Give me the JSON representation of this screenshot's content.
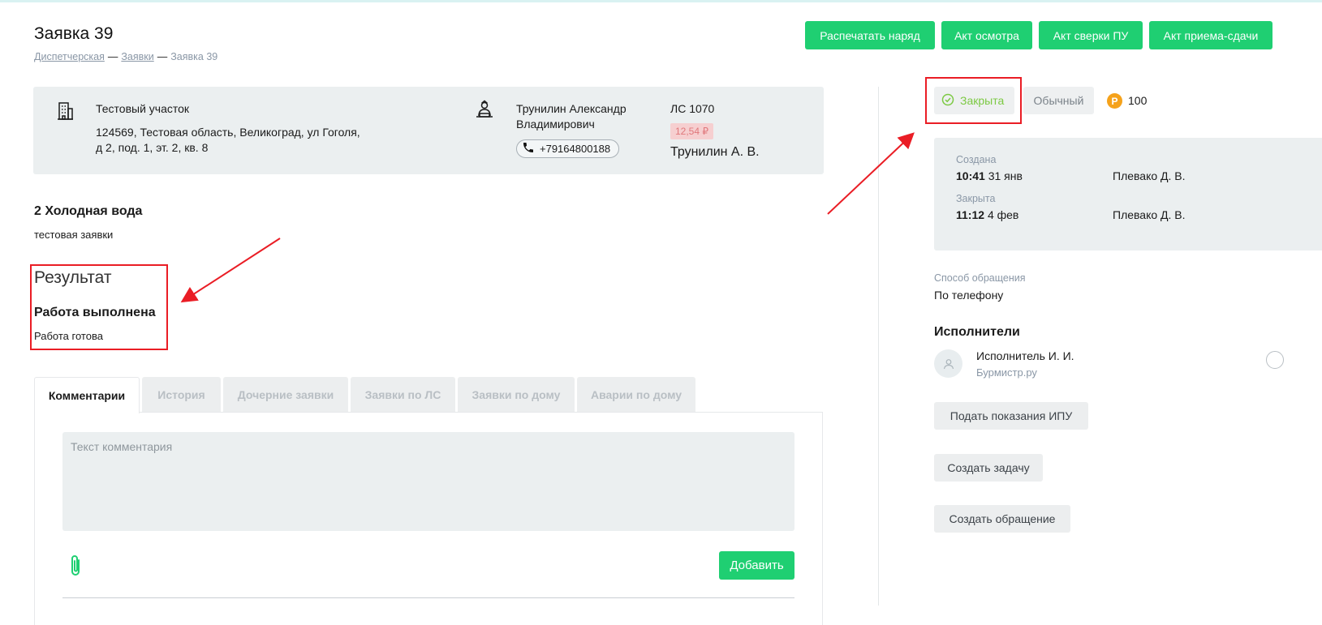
{
  "header": {
    "title": "Заявка 39",
    "breadcrumb": [
      "Диспетчерская",
      "Заявки",
      "Заявка 39"
    ],
    "buttons": [
      "Распечатать наряд",
      "Акт осмотра",
      "Акт сверки ПУ",
      "Акт приема-сдачи"
    ]
  },
  "info": {
    "site_name": "Тестовый участок",
    "address_line1": "124569, Тестовая область, Великоград, ул Гоголя,",
    "address_line2": "д 2, под. 1, эт. 2, кв. 8",
    "person_line1": "Трунилин Александр",
    "person_line2": "Владимирович",
    "phone": "+79164800188",
    "account": "ЛС 1070",
    "debt": "12,54 ₽",
    "owner_short": "Трунилин А. В."
  },
  "request": {
    "service": "2 Холодная вода",
    "description": "тестовая заявки"
  },
  "result": {
    "heading": "Результат",
    "status": "Работа выполнена",
    "description": "Работа готова"
  },
  "tabs": [
    "Комментарии",
    "История",
    "Дочерние заявки",
    "Заявки по ЛС",
    "Заявки по дому",
    "Аварии по дому"
  ],
  "comment": {
    "placeholder": "Текст комментария",
    "add_label": "Добавить"
  },
  "side": {
    "status": "Закрыта",
    "priority": "Обычный",
    "coin_symbol": "Р",
    "points": "100",
    "created_label": "Создана",
    "created_time": "10:41",
    "created_date": "31 янв",
    "created_by": "Плевако Д. В.",
    "closed_label": "Закрыта",
    "closed_time": "11:12",
    "closed_date": "4 фев",
    "closed_by": "Плевако Д. В.",
    "contact_label": "Способ обращения",
    "contact_value": "По телефону",
    "executors_title": "Исполнители",
    "executor_name": "Исполнитель И. И.",
    "executor_org": "Бурмистр.ру",
    "buttons": [
      "Подать показания ИПУ",
      "Создать задачу",
      "Создать обращение"
    ]
  },
  "colors": {
    "accent_green": "#1fcf72",
    "status_green": "#7cc943",
    "annotation_red": "#ea1d25",
    "panel_bg": "#ebeff0"
  }
}
